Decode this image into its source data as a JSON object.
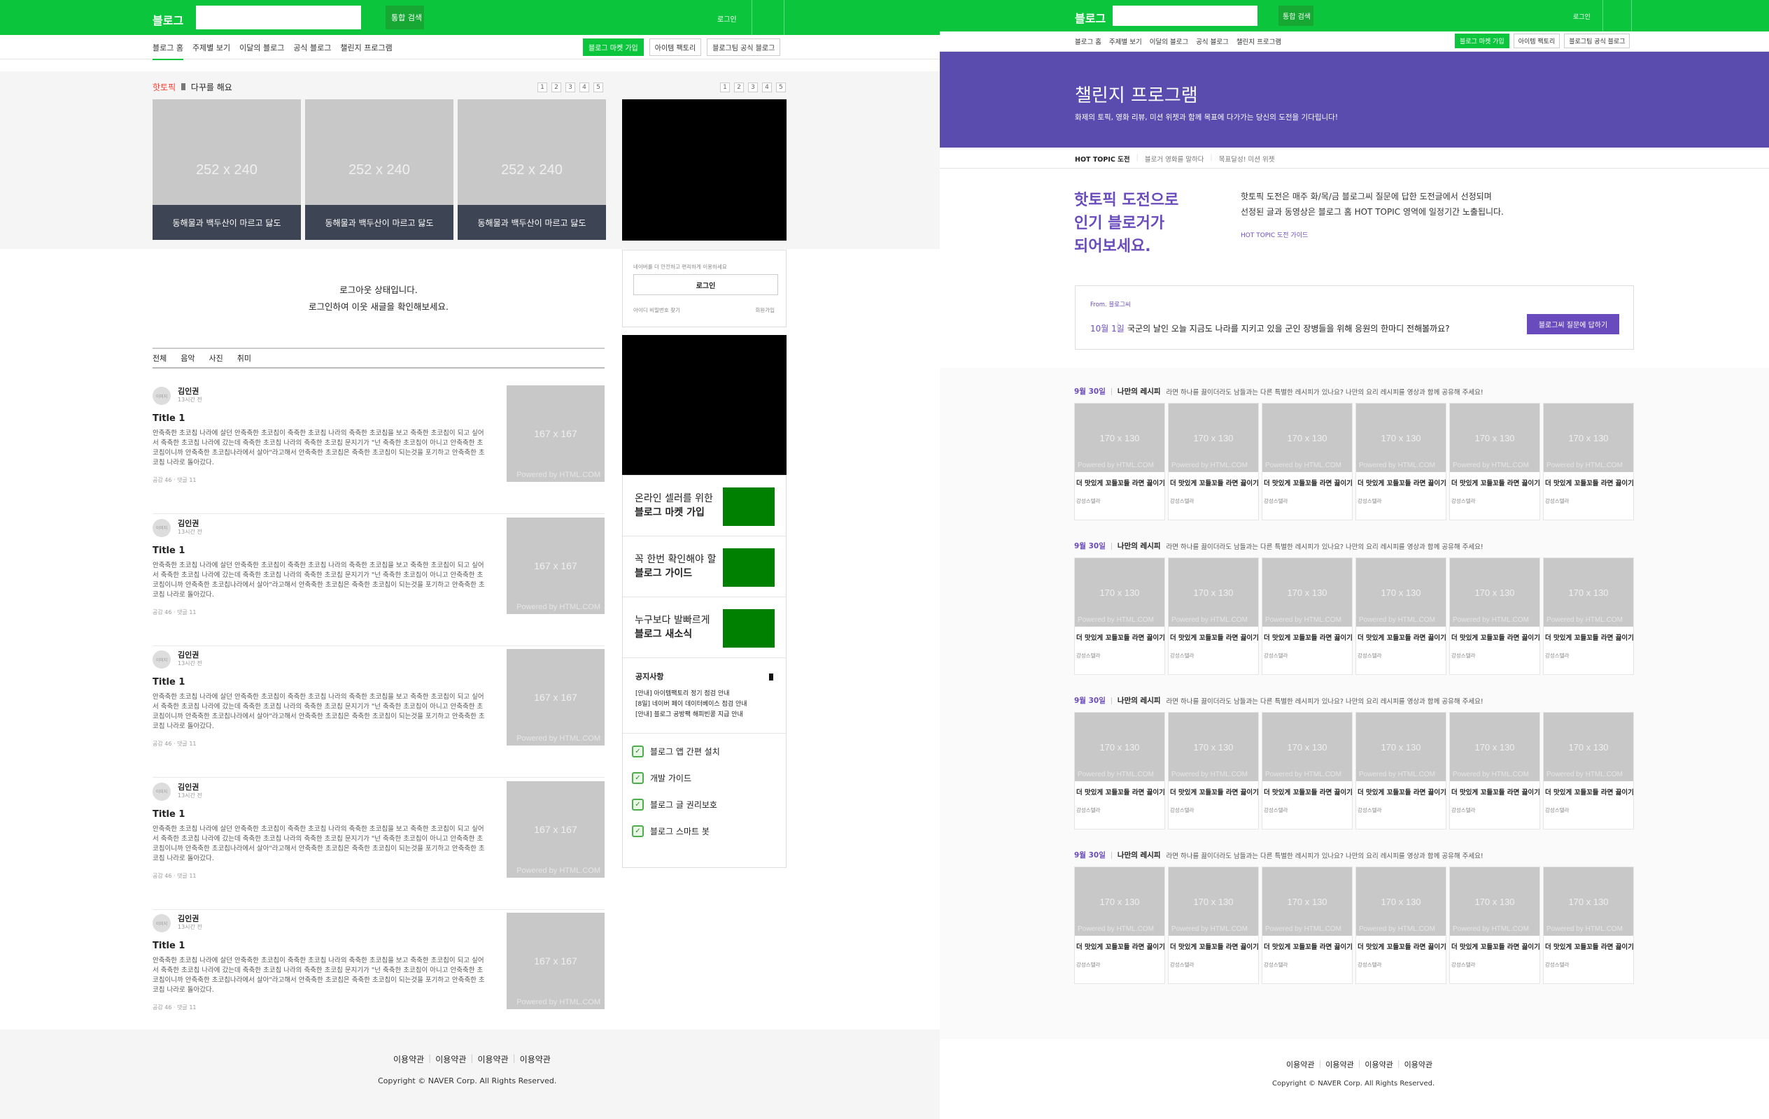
{
  "left": {
    "header": {
      "logo": "블로그",
      "search_button": "통합 검색",
      "login": "로그인"
    },
    "gnb": {
      "items": [
        "블로그 홈",
        "주제별 보기",
        "이달의 블로그",
        "공식 블로그",
        "챌린지 프로그램"
      ],
      "buttons": [
        "블로그 마켓 가입",
        "아이템 팩토리",
        "블로그팀 공식 블로그"
      ]
    },
    "hot": {
      "label": "핫토픽",
      "title": "다꾸를 해요",
      "pages": [
        "1",
        "2",
        "3",
        "4",
        "5"
      ],
      "side_pages": [
        "1",
        "2",
        "3",
        "4",
        "5"
      ],
      "cards": [
        {
          "img": "252 x 240",
          "caption": "동해물과 백두산이 마르고 닳도"
        },
        {
          "img": "252 x 240",
          "caption": "동해물과 백두산이 마르고 닳도"
        },
        {
          "img": "252 x 240",
          "caption": "동해물과 백두산이 마르고 닳도"
        }
      ]
    },
    "logout": {
      "line1": "로그아웃 상태입니다.",
      "line2": "로그인하여 이웃 새글을 확인해보세요."
    },
    "tabs": [
      "전체",
      "음악",
      "사진",
      "취미"
    ],
    "posts": [
      {
        "avatar": "이미지",
        "name": "김인권",
        "time": "13시간 전",
        "title": "Title 1",
        "body": "안축축한 초코칩 나라에 살던 안축축한 초코칩이 축축한 초코칩 나라의 축축한 초코칩을 보고 축축한 초코칩이 되고 싶어서 축축한 초코칩 나라에 갔는데 축축한 초코칩 나라의 축축한 초코칩 문지기가 \"넌 축축한 초코칩이 아니고 안축축한 초코칩이니까 안축축한 초코칩나라에서 살아\"라고해서 안축축한 초코칩은 축축한 초코칩이 되는것을 포기하고 안축축한 초코칩 나라로 돌아갔다.",
        "meta": "공감 46 · 댓글 11",
        "img": "167 x 167",
        "powered": "Powered by HTML.COM"
      },
      {
        "avatar": "이미지",
        "name": "김인권",
        "time": "13시간 전",
        "title": "Title 1",
        "body": "안축축한 초코칩 나라에 살던 안축축한 초코칩이 축축한 초코칩 나라의 축축한 초코칩을 보고 축축한 초코칩이 되고 싶어서 축축한 초코칩 나라에 갔는데 축축한 초코칩 나라의 축축한 초코칩 문지기가 \"넌 축축한 초코칩이 아니고 안축축한 초코칩이니까 안축축한 초코칩나라에서 살아\"라고해서 안축축한 초코칩은 축축한 초코칩이 되는것을 포기하고 안축축한 초코칩 나라로 돌아갔다.",
        "meta": "공감 46 · 댓글 11",
        "img": "167 x 167",
        "powered": "Powered by HTML.COM"
      },
      {
        "avatar": "이미지",
        "name": "김인권",
        "time": "13시간 전",
        "title": "Title 1",
        "body": "안축축한 초코칩 나라에 살던 안축축한 초코칩이 축축한 초코칩 나라의 축축한 초코칩을 보고 축축한 초코칩이 되고 싶어서 축축한 초코칩 나라에 갔는데 축축한 초코칩 나라의 축축한 초코칩 문지기가 \"넌 축축한 초코칩이 아니고 안축축한 초코칩이니까 안축축한 초코칩나라에서 살아\"라고해서 안축축한 초코칩은 축축한 초코칩이 되는것을 포기하고 안축축한 초코칩 나라로 돌아갔다.",
        "meta": "공감 46 · 댓글 11",
        "img": "167 x 167",
        "powered": "Powered by HTML.COM"
      },
      {
        "avatar": "이미지",
        "name": "김인권",
        "time": "13시간 전",
        "title": "Title 1",
        "body": "안축축한 초코칩 나라에 살던 안축축한 초코칩이 축축한 초코칩 나라의 축축한 초코칩을 보고 축축한 초코칩이 되고 싶어서 축축한 초코칩 나라에 갔는데 축축한 초코칩 나라의 축축한 초코칩 문지기가 \"넌 축축한 초코칩이 아니고 안축축한 초코칩이니까 안축축한 초코칩나라에서 살아\"라고해서 안축축한 초코칩은 축축한 초코칩이 되는것을 포기하고 안축축한 초코칩 나라로 돌아갔다.",
        "meta": "공감 46 · 댓글 11",
        "img": "167 x 167",
        "powered": "Powered by HTML.COM"
      },
      {
        "avatar": "이미지",
        "name": "김인권",
        "time": "13시간 전",
        "title": "Title 1",
        "body": "안축축한 초코칩 나라에 살던 안축축한 초코칩이 축축한 초코칩 나라의 축축한 초코칩을 보고 축축한 초코칩이 되고 싶어서 축축한 초코칩 나라에 갔는데 축축한 초코칩 나라의 축축한 초코칩 문지기가 \"넌 축축한 초코칩이 아니고 안축축한 초코칩이니까 안축축한 초코칩나라에서 살아\"라고해서 안축축한 초코칩은 축축한 초코칩이 되는것을 포기하고 안축축한 초코칩 나라로 돌아갔다.",
        "meta": "공감 46 · 댓글 11",
        "img": "167 x 167",
        "powered": "Powered by HTML.COM"
      }
    ],
    "login_box": {
      "desc": "네이버를 더 안전하고 편리하게 이용하세요",
      "button": "로그인",
      "find": "아이디 비밀번호 찾기",
      "join": "회원가입"
    },
    "features": [
      {
        "line1": "온라인 셀러를 위한",
        "line2": "블로그 마켓 가입"
      },
      {
        "line1": "꼭 한번 확인해야 할",
        "line2": "블로그 가이드"
      },
      {
        "line1": "누구보다 발빠르게",
        "line2": "블로그 새소식"
      }
    ],
    "notice": {
      "title": "공지사항",
      "items": [
        "[안내] 아이템팩토리 정기 점검 안내",
        "[8일] 네이버 페이 데이터베이스 점검 안내",
        "[안내] 블로그 공방팩 해피빈콩 지급 안내"
      ]
    },
    "utils": [
      "블로그 앱 간편 설치",
      "개발 가이드",
      "블로그 글 권리보호",
      "블로그 스마트 봇"
    ],
    "footer": {
      "links": [
        "이용약관",
        "이용약관",
        "이용약관",
        "이용약관"
      ],
      "copyright": "Copyright © NAVER Corp. All Rights Reserved."
    }
  },
  "right": {
    "header": {
      "logo": "블로그",
      "search_button": "통합 검색",
      "login": "로그인"
    },
    "gnb": {
      "items": [
        "블로그 홈",
        "주제별 보기",
        "이달의 블로그",
        "공식 블로그",
        "챌린지 프로그램"
      ],
      "buttons": [
        "블로그 마켓 가입",
        "아이템 팩토리",
        "블로그팀 공식 블로그"
      ]
    },
    "banner": {
      "title": "챌린지 프로그램",
      "subtitle": "화제의 토픽, 영화 리뷰, 미션 위젯과 함께 목표에 다가가는 당신의 도전을 기다립니다!"
    },
    "subtabs": [
      "HOT TOPIC 도전",
      "블로거 영화를 말하다",
      "목표달성! 미션 위젯"
    ],
    "intro": {
      "headline": [
        "핫토픽 도전으로",
        "인기 블로거가",
        "되어보세요."
      ],
      "desc1": "핫토픽 도전은 매주 화/목/금 블로그씨 질문에 답한 도전글에서 선정되며",
      "desc2": "선정된 글과 동영상은 블로그 홈 HOT TOPIC 영역에 일정기간 노출됩니다.",
      "guide": "HOT TOPIC 도전 가이드"
    },
    "question": {
      "from": "From. 블로그씨",
      "date": "10월 1일",
      "text": "국군의 날인 오늘 지금도 나라를 지키고 있을 군인 장병들을 위해 응원의 한마디 전해볼까요?",
      "button": "블로그씨 질문에 답하기"
    },
    "rows": [
      {
        "date": "9월 30일",
        "keyword": "나만의 레시피",
        "desc": "라면 하나를 끓이더라도 남들과는 다른 특별한 레시피가 있나요? 나만의 요리 레시피를 영상과 함께 공유해 주세요!"
      },
      {
        "date": "9월 30일",
        "keyword": "나만의 레시피",
        "desc": "라면 하나를 끓이더라도 남들과는 다른 특별한 레시피가 있나요? 나만의 요리 레시피를 영상과 함께 공유해 주세요!"
      },
      {
        "date": "9월 30일",
        "keyword": "나만의 레시피",
        "desc": "라면 하나를 끓이더라도 남들과는 다른 특별한 레시피가 있나요? 나만의 요리 레시피를 영상과 함께 공유해 주세요!"
      },
      {
        "date": "9월 30일",
        "keyword": "나만의 레시피",
        "desc": "라면 하나를 끓이더라도 남들과는 다른 특별한 레시피가 있나요? 나만의 요리 레시피를 영상과 함께 공유해 주세요!"
      }
    ],
    "card": {
      "img": "170 x 130",
      "powered": "Powered by HTML.COM",
      "title": "더 맛있게 꼬들꼬들 라면 끓이기",
      "author": "강성스텔라"
    },
    "footer": {
      "links": [
        "이용약관",
        "이용약관",
        "이용약관",
        "이용약관"
      ],
      "copyright": "Copyright © NAVER Corp. All Rights Reserved."
    }
  },
  "colors": {
    "brand_green": "#0bc63c",
    "banner_purple": "#5a4baf",
    "accent_purple": "#6a4bbd",
    "hot_red": "#ff3b30",
    "feature_green": "#008000"
  }
}
